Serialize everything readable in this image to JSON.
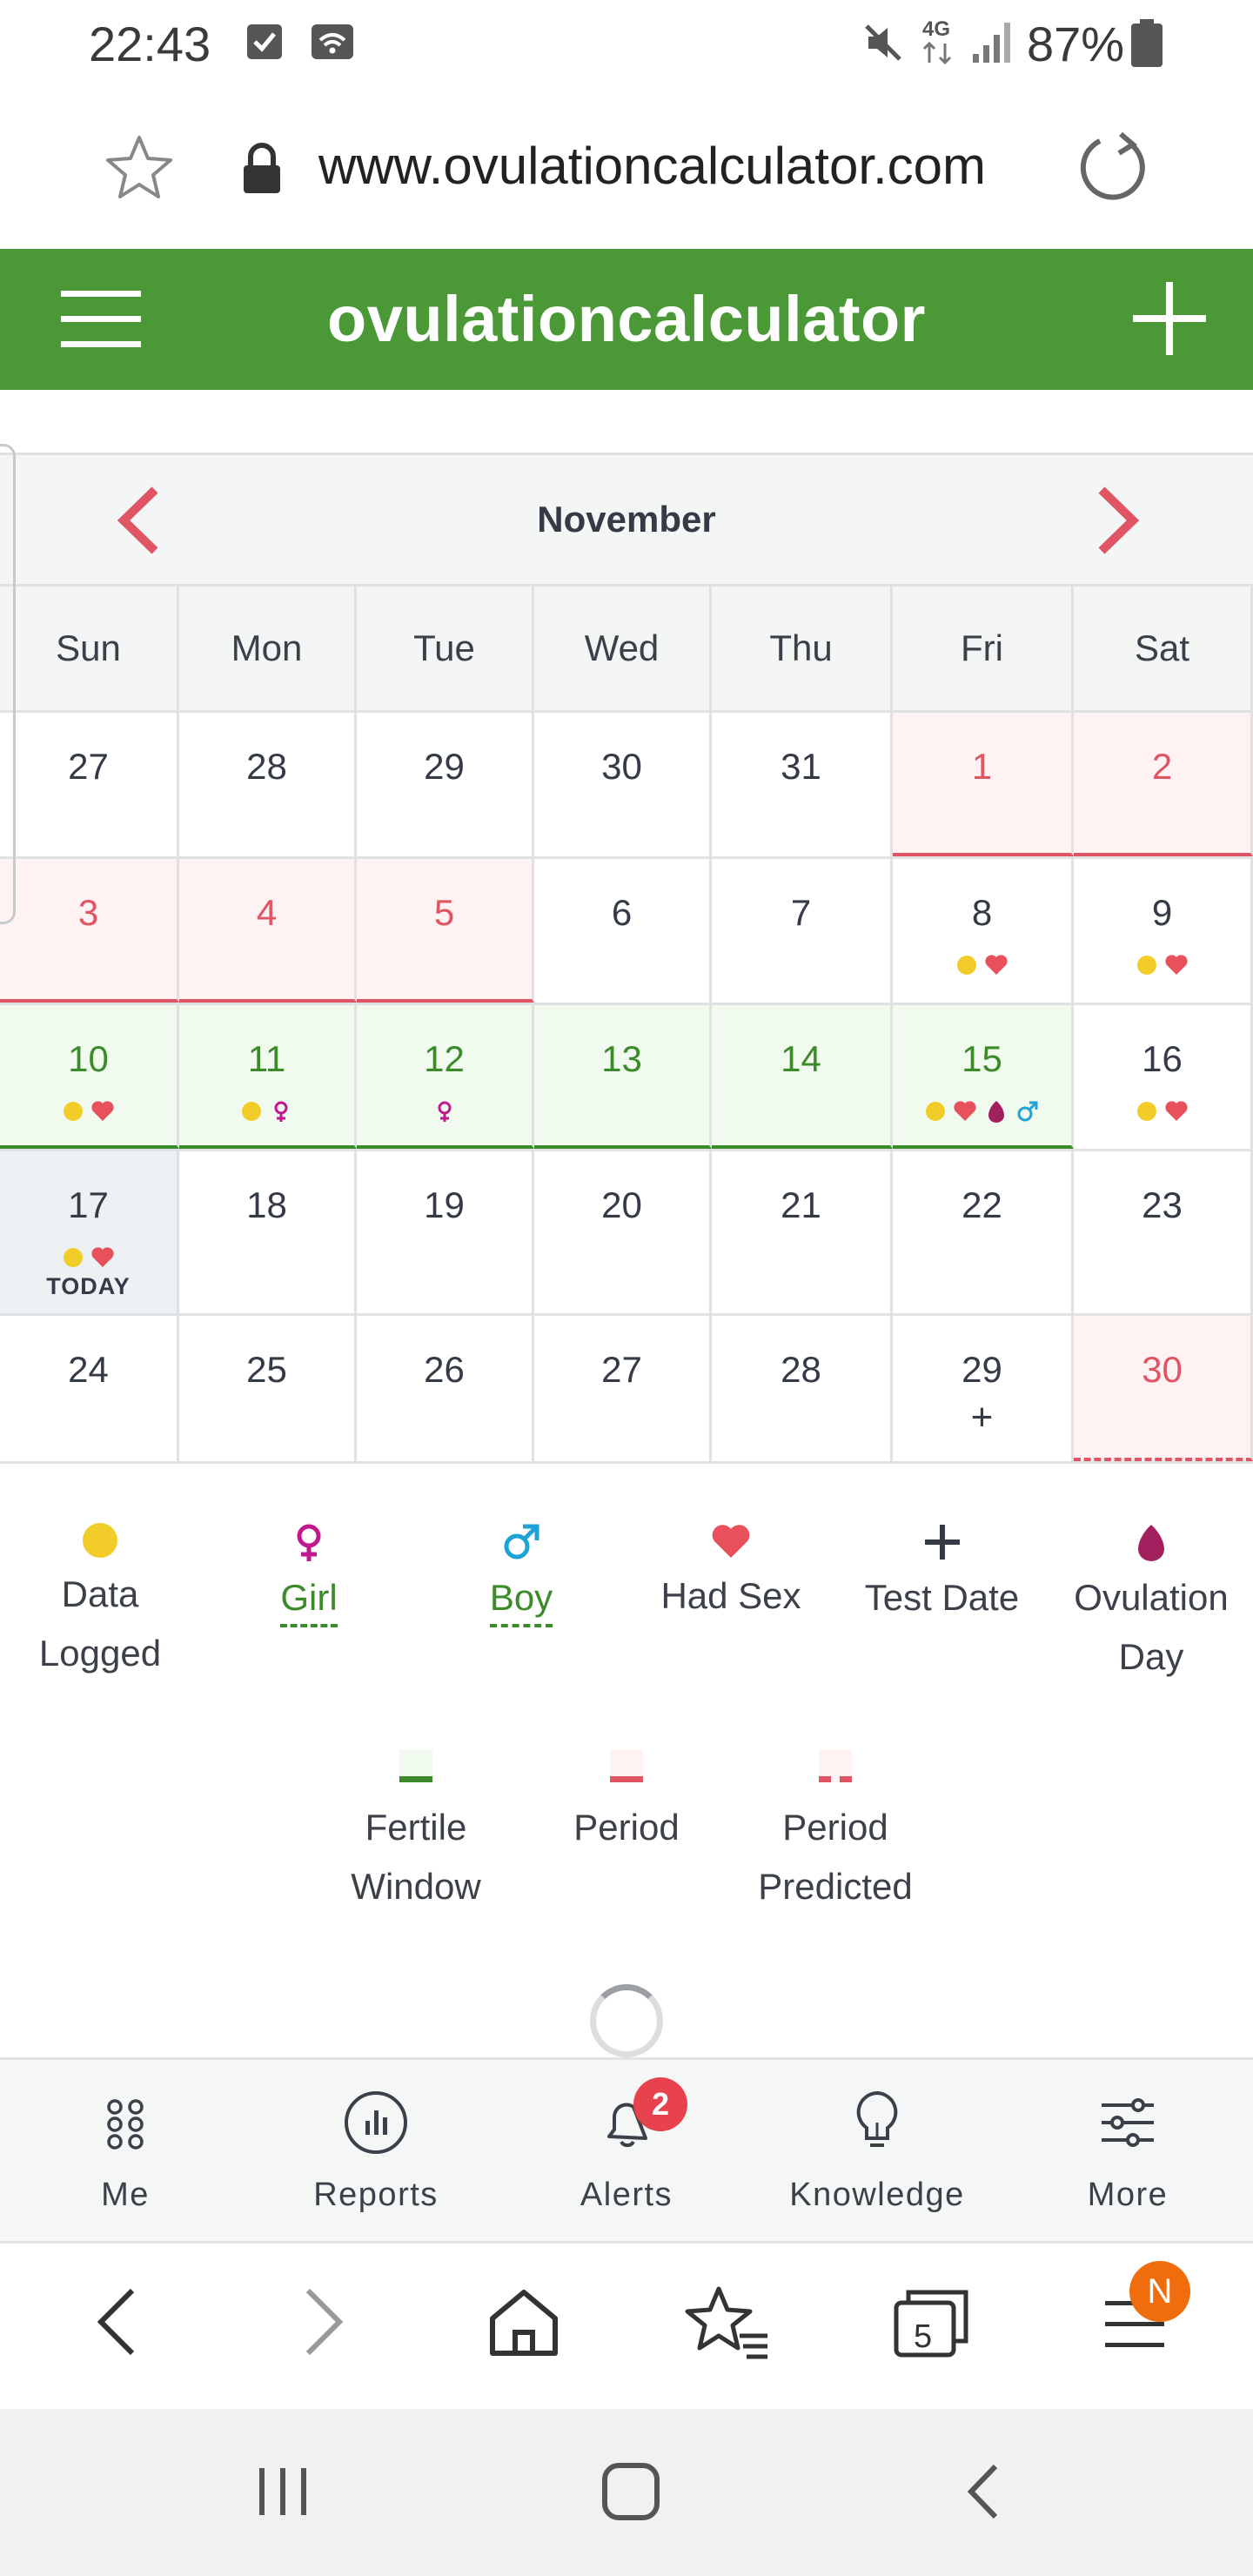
{
  "status_bar": {
    "time": "22:43",
    "network": "4G",
    "battery": "87%",
    "icons": [
      "checkbox-notification-icon",
      "wifi-calling-icon",
      "mute-icon",
      "signal-icon",
      "battery-icon"
    ]
  },
  "browser": {
    "url": "www.ovulationcalculator.com",
    "tab_count": "5",
    "menu_badge": "N"
  },
  "app": {
    "title": "ovulationcalculator",
    "brand_color": "#4b9836"
  },
  "calendar": {
    "month": "November",
    "weekdays": [
      "Sun",
      "Mon",
      "Tue",
      "Wed",
      "Thu",
      "Fri",
      "Sat"
    ],
    "today_label": "TODAY",
    "weeks": [
      [
        {
          "day": "27",
          "type": "",
          "marks": []
        },
        {
          "day": "28",
          "type": "",
          "marks": []
        },
        {
          "day": "29",
          "type": "",
          "marks": []
        },
        {
          "day": "30",
          "type": "",
          "marks": []
        },
        {
          "day": "31",
          "type": "",
          "marks": []
        },
        {
          "day": "1",
          "type": "period",
          "marks": []
        },
        {
          "day": "2",
          "type": "period",
          "marks": []
        }
      ],
      [
        {
          "day": "3",
          "type": "period",
          "marks": []
        },
        {
          "day": "4",
          "type": "period",
          "marks": []
        },
        {
          "day": "5",
          "type": "period",
          "marks": []
        },
        {
          "day": "6",
          "type": "",
          "marks": []
        },
        {
          "day": "7",
          "type": "",
          "marks": []
        },
        {
          "day": "8",
          "type": "",
          "marks": [
            "data",
            "sex"
          ]
        },
        {
          "day": "9",
          "type": "",
          "marks": [
            "data",
            "sex"
          ]
        }
      ],
      [
        {
          "day": "10",
          "type": "fertile",
          "marks": [
            "data",
            "sex"
          ]
        },
        {
          "day": "11",
          "type": "fertile",
          "marks": [
            "data",
            "girl"
          ]
        },
        {
          "day": "12",
          "type": "fertile",
          "marks": [
            "girl"
          ]
        },
        {
          "day": "13",
          "type": "fertile",
          "marks": []
        },
        {
          "day": "14",
          "type": "fertile",
          "marks": []
        },
        {
          "day": "15",
          "type": "fertile",
          "marks": [
            "data",
            "sex",
            "ovulation",
            "boy"
          ]
        },
        {
          "day": "16",
          "type": "",
          "marks": [
            "data",
            "sex"
          ]
        }
      ],
      [
        {
          "day": "17",
          "type": "today",
          "marks": [
            "data",
            "sex"
          ]
        },
        {
          "day": "18",
          "type": "",
          "marks": []
        },
        {
          "day": "19",
          "type": "",
          "marks": []
        },
        {
          "day": "20",
          "type": "",
          "marks": []
        },
        {
          "day": "21",
          "type": "",
          "marks": []
        },
        {
          "day": "22",
          "type": "",
          "marks": []
        },
        {
          "day": "23",
          "type": "",
          "marks": []
        }
      ],
      [
        {
          "day": "24",
          "type": "",
          "marks": []
        },
        {
          "day": "25",
          "type": "",
          "marks": []
        },
        {
          "day": "26",
          "type": "",
          "marks": []
        },
        {
          "day": "27",
          "type": "",
          "marks": []
        },
        {
          "day": "28",
          "type": "",
          "marks": []
        },
        {
          "day": "29",
          "type": "",
          "marks": [
            "test"
          ]
        },
        {
          "day": "30",
          "type": "period-predicted",
          "marks": []
        }
      ]
    ]
  },
  "legend": {
    "data_logged": "Data Logged",
    "girl": "Girl",
    "boy": "Boy",
    "had_sex": "Had Sex",
    "test_date": "Test Date",
    "ovulation_day": "Ovulation Day",
    "fertile_window": "Fertile Window",
    "period": "Period",
    "period_predicted": "Period Predicted"
  },
  "colors": {
    "period": "#df5564",
    "fertile": "#3c8b2a",
    "data_dot": "#f2cd2a",
    "girl": "#c2188f",
    "boy": "#1ea3d6",
    "heart": "#e8505b",
    "ovulation": "#a3205f"
  },
  "tab_bar": {
    "me": "Me",
    "reports": "Reports",
    "alerts": "Alerts",
    "alerts_badge": "2",
    "knowledge": "Knowledge",
    "more": "More"
  }
}
